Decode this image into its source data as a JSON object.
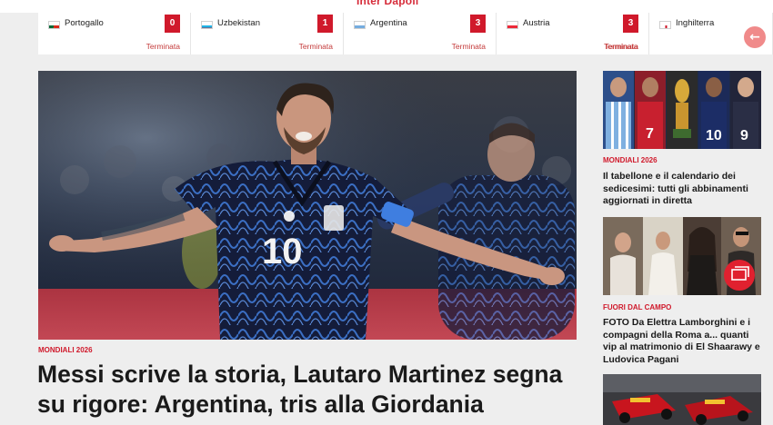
{
  "site": {
    "logo_text": "Inter Dapoli"
  },
  "colors": {
    "accent": "#d0192b",
    "score_bg": "#d0192b",
    "prev_button": "#f08a8a"
  },
  "matches": [
    {
      "team": "Portogallo",
      "score": "0",
      "status": "Terminata",
      "flag_icon": "flag-portugal-icon"
    },
    {
      "team": "Uzbekistan",
      "score": "1",
      "status": "Terminata",
      "flag_icon": "flag-uzbekistan-icon"
    },
    {
      "team": "Argentina",
      "score": "3",
      "status": "Terminata",
      "flag_icon": "flag-argentina-icon"
    },
    {
      "team": "Austria",
      "score": "3",
      "status": "Terminata",
      "flag_icon": "flag-austria-icon"
    },
    {
      "team": "Inghilterra",
      "score": "",
      "status": "Terminata",
      "flag_icon": "flag-england-icon"
    }
  ],
  "scorebar": {
    "prev_icon": "arrow-left-icon",
    "prev_glyph": "←"
  },
  "hero": {
    "category": "MONDIALI 2026",
    "title": "Messi scrive la storia, Lautaro Martinez segna su rigore: Argentina, tris alla Giordania",
    "jersey_number": "10"
  },
  "sidebar": {
    "articles": [
      {
        "category": "MONDIALI 2026",
        "title": "Il tabellone e il calendario dei sedicesimi: tutti gli abbinamenti aggiornati in diretta"
      },
      {
        "category": "FUORI DAL CAMPO",
        "title": "FOTO Da Elettra Lamborghini e i compagni della Roma a... quanti vip al matrimonio di El Shaarawy e Ludovica Pagani",
        "badge_icon": "gallery-icon"
      },
      {
        "category": "",
        "title": ""
      }
    ]
  }
}
